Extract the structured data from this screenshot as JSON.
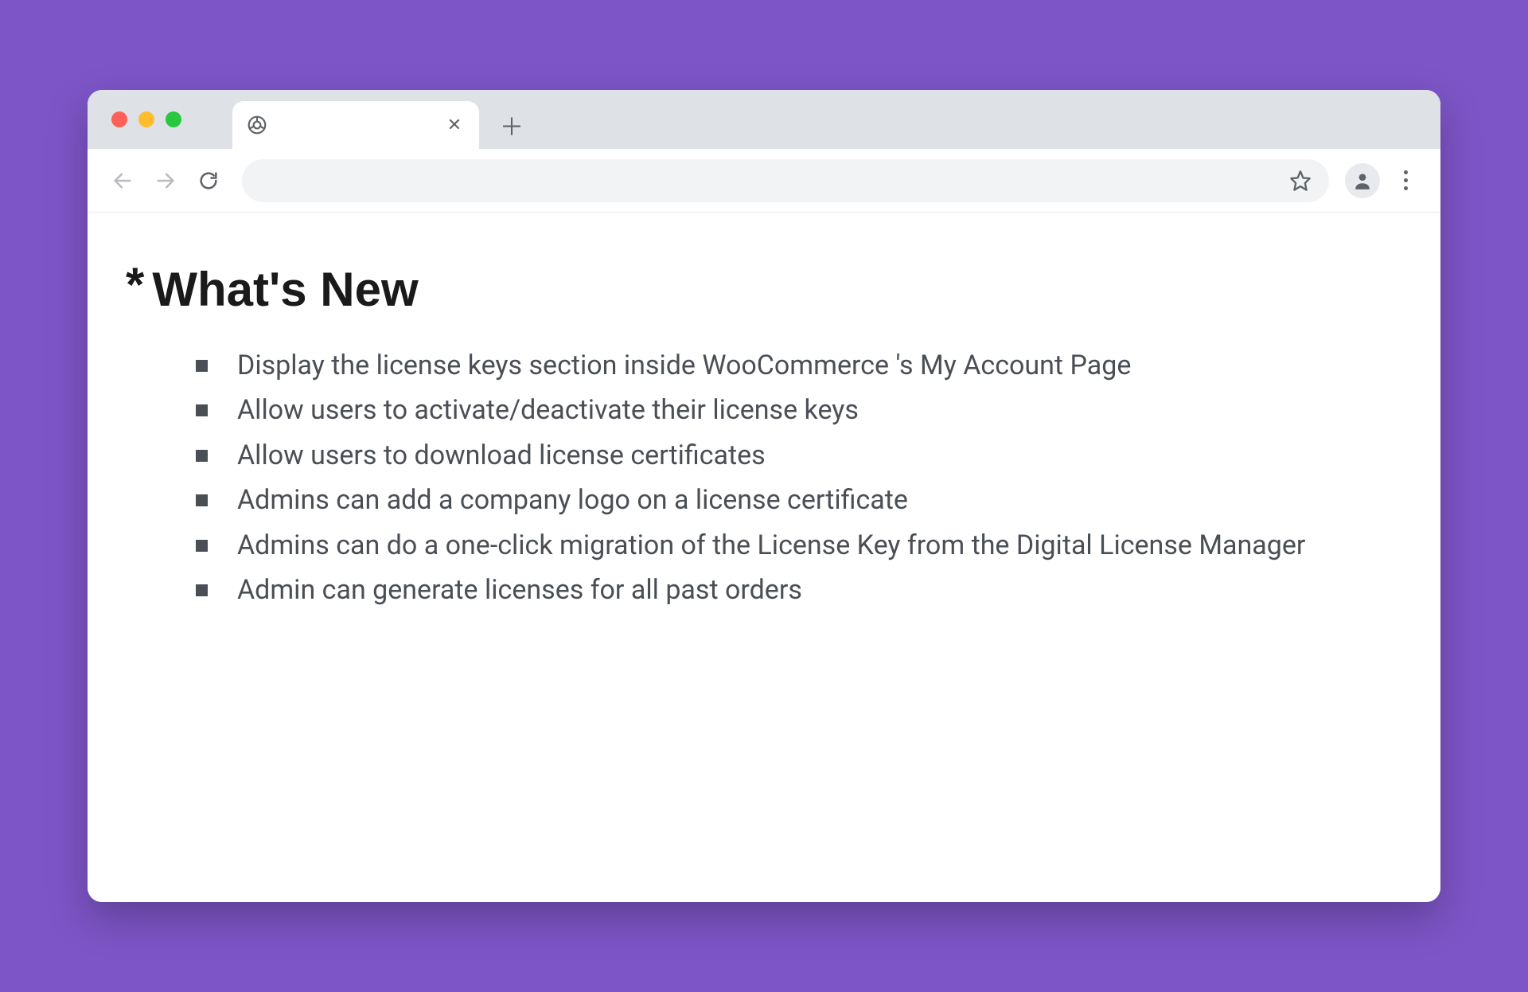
{
  "browser": {
    "traffic": [
      "red",
      "yellow",
      "green"
    ],
    "tab_close_glyph": "✕",
    "new_tab_glyph": "＋"
  },
  "page": {
    "heading_prefix": "*",
    "heading_text": "What's New",
    "features": [
      "Display the license keys section inside WooCommerce 's My Account Page",
      "Allow users to activate/deactivate their license keys",
      "Allow users to download license certificates",
      "Admins can add a company logo on a license certificate",
      "Admins can do a one-click migration of the License Key from the Digital License Manager",
      "Admin can generate licenses for all past orders"
    ]
  }
}
